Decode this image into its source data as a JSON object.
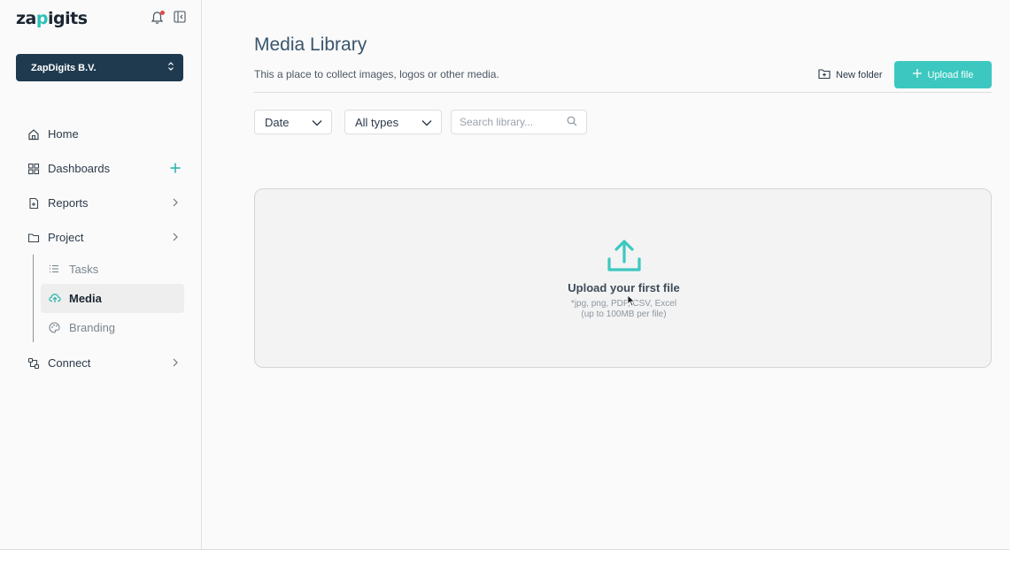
{
  "brand": {
    "logo_pre": "za",
    "logo_accent": "p",
    "logo_post": "igits"
  },
  "organization": {
    "name": "ZapDigits B.V."
  },
  "nav": {
    "home": "Home",
    "dashboards": "Dashboards",
    "reports": "Reports",
    "project": "Project",
    "sub": {
      "tasks": "Tasks",
      "media": "Media",
      "branding": "Branding"
    },
    "connect": "Connect"
  },
  "page": {
    "title": "Media Library",
    "subtitle": "This a place to collect images, logos or other media.",
    "new_folder": "New folder",
    "upload_file": "Upload file"
  },
  "filters": {
    "date": "Date",
    "types": "All types",
    "search_placeholder": "Search library..."
  },
  "dropzone": {
    "title": "Upload your first file",
    "formats": "*jpg, png, PDF, CSV, Excel",
    "limit": "(up to 100MB per file)"
  },
  "colors": {
    "accent": "#3cc8c0",
    "org_bg": "#1f3a4f",
    "title": "#3a556c"
  },
  "icons": [
    "bell-icon",
    "collapse-sidebar-icon",
    "home-icon",
    "grid-icon",
    "report-icon",
    "folder-icon",
    "list-icon",
    "cloud-upload-icon",
    "palette-icon",
    "connect-icon",
    "new-folder-icon",
    "plus-icon",
    "chevron-down-icon",
    "search-icon",
    "upload-icon"
  ]
}
